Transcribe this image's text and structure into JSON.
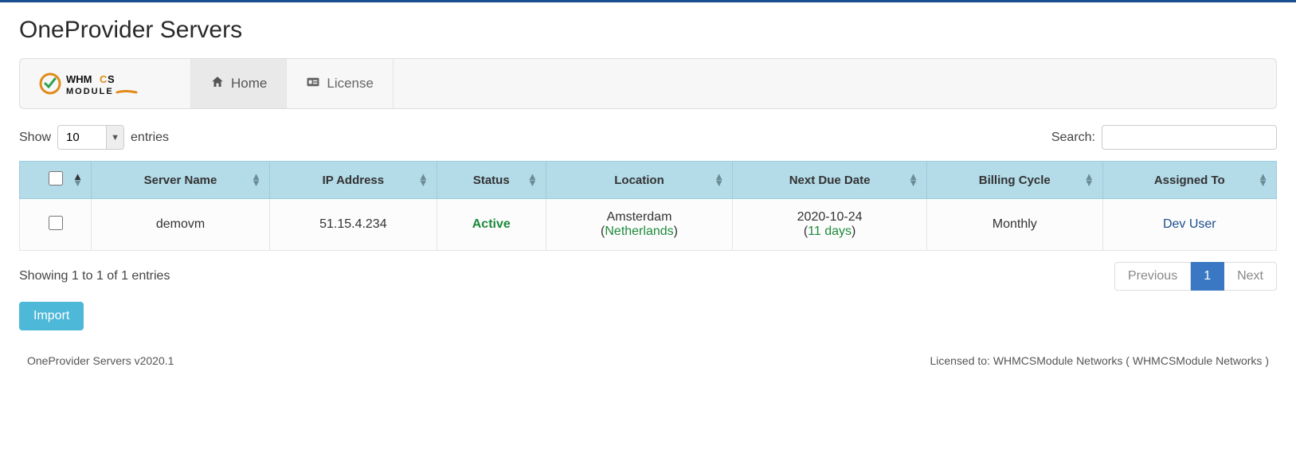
{
  "page": {
    "title": "OneProvider Servers"
  },
  "nav": {
    "home_label": "Home",
    "license_label": "License"
  },
  "lengthMenu": {
    "show_label": "Show",
    "entries_label": "entries",
    "selected": "10"
  },
  "search": {
    "label": "Search:"
  },
  "columns": {
    "server_name": "Server Name",
    "ip_address": "IP Address",
    "status": "Status",
    "location": "Location",
    "next_due": "Next Due Date",
    "billing_cycle": "Billing Cycle",
    "assigned_to": "Assigned To"
  },
  "rows": [
    {
      "server_name": "demovm",
      "ip_address": "51.15.4.234",
      "status": "Active",
      "location_city": "Amsterdam",
      "location_country": "Netherlands",
      "next_due_date": "2020-10-24",
      "next_due_days": "11 days",
      "billing_cycle": "Monthly",
      "assigned_to": "Dev User"
    }
  ],
  "tableInfo": "Showing 1 to 1 of 1 entries",
  "pagination": {
    "previous": "Previous",
    "next": "Next",
    "current": "1"
  },
  "buttons": {
    "import": "Import"
  },
  "footer": {
    "version": "OneProvider Servers v2020.1",
    "license": "Licensed to: WHMCSModule Networks ( WHMCSModule Networks )"
  }
}
